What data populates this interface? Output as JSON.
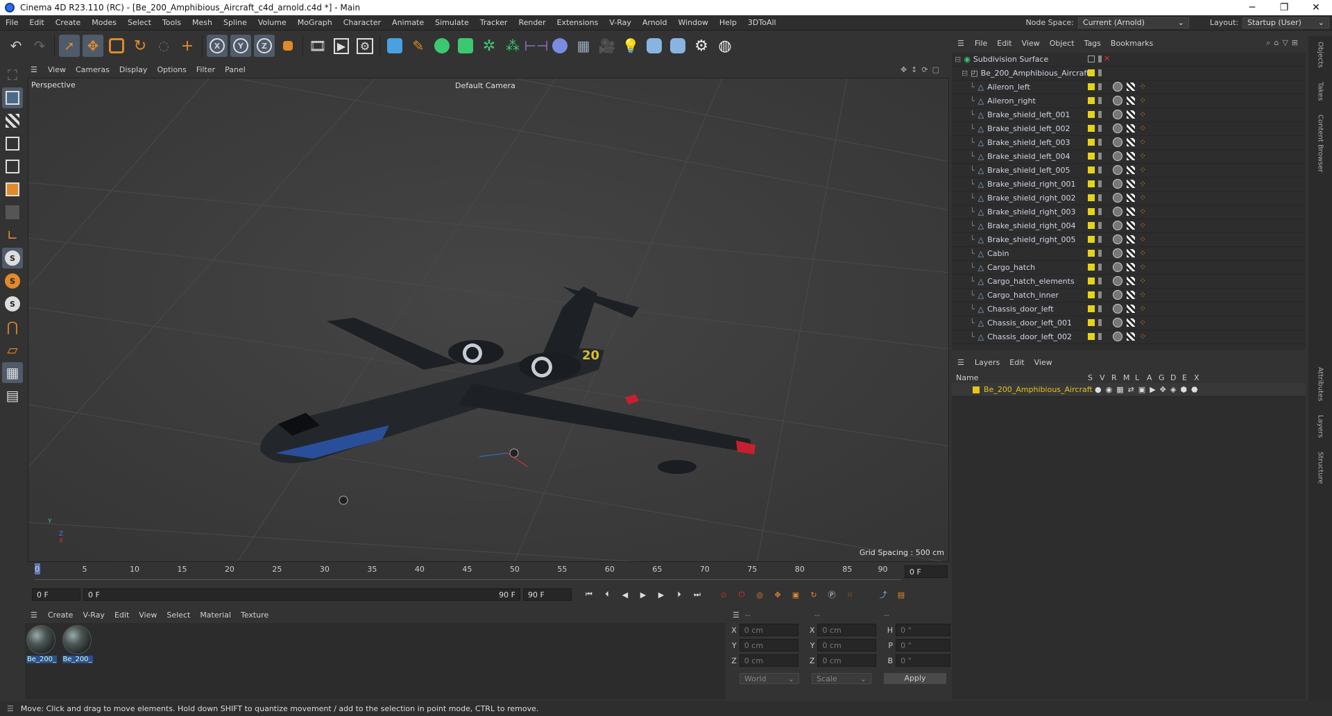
{
  "window": {
    "title": "Cinema 4D R23.110 (RC) - [Be_200_Amphibious_Aircraft_c4d_arnold.c4d *] - Main",
    "controls": [
      "─",
      "❐",
      "✕"
    ]
  },
  "menubar": {
    "items": [
      "File",
      "Edit",
      "Create",
      "Modes",
      "Select",
      "Tools",
      "Mesh",
      "Spline",
      "Volume",
      "MoGraph",
      "Character",
      "Animate",
      "Simulate",
      "Tracker",
      "Render",
      "Extensions",
      "V-Ray",
      "Arnold",
      "Window",
      "Help",
      "3DToAll"
    ],
    "node_space_label": "Node Space:",
    "node_space_value": "Current (Arnold)",
    "layout_label": "Layout:",
    "layout_value": "Startup (User)"
  },
  "toolbar": {
    "icons": [
      "undo-icon",
      "redo-icon",
      "select-icon",
      "move-icon",
      "scale-icon",
      "rotate-icon",
      "last-tool-icon",
      "recent-icon",
      "x-axis-icon",
      "y-axis-icon",
      "z-axis-icon",
      "coord-system-icon",
      "render-region-icon",
      "render-view-icon",
      "render-settings-icon",
      "cube-icon",
      "pen-icon",
      "subdivision-icon",
      "extrude-icon",
      "cloner-icon",
      "array-icon",
      "symmetry-icon",
      "deformer-icon",
      "floor-icon",
      "camera-icon",
      "light-icon",
      "python-icon",
      "python2-icon",
      "gear-icon",
      "globe-icon"
    ]
  },
  "viewport": {
    "menu": [
      "View",
      "Cameras",
      "Display",
      "Options",
      "Filter",
      "Panel"
    ],
    "label": "Perspective",
    "camera": "Default Camera",
    "grid_spacing": "Grid Spacing : 500 cm",
    "axis": {
      "y": "Y",
      "z": "Z",
      "x": "X"
    }
  },
  "timeline": {
    "ticks": [
      "0",
      "5",
      "10",
      "15",
      "20",
      "25",
      "30",
      "35",
      "40",
      "45",
      "50",
      "55",
      "60",
      "65",
      "70",
      "75",
      "80",
      "85",
      "90"
    ],
    "current_frame": "0 F",
    "start": "0 F",
    "range_start": "0 F",
    "range_end": "90 F",
    "end": "90 F"
  },
  "material": {
    "menu": [
      "Create",
      "V-Ray",
      "Edit",
      "View",
      "Select",
      "Material",
      "Texture"
    ],
    "items": [
      {
        "name": "Be_200_"
      },
      {
        "name": "Be_200_"
      }
    ]
  },
  "coords": {
    "header": [
      "--",
      "--",
      "--"
    ],
    "rows": [
      {
        "a": "X",
        "av": "0 cm",
        "b": "X",
        "bv": "0 cm",
        "c": "H",
        "cv": "0 °"
      },
      {
        "a": "Y",
        "av": "0 cm",
        "b": "Y",
        "bv": "0 cm",
        "c": "P",
        "cv": "0 °"
      },
      {
        "a": "Z",
        "av": "0 cm",
        "b": "Z",
        "bv": "0 cm",
        "c": "B",
        "cv": "0 °"
      }
    ],
    "world": "World",
    "scale": "Scale",
    "apply": "Apply"
  },
  "status": "Move: Click and drag to move elements. Hold down SHIFT to quantize movement / add to the selection in point mode, CTRL to remove.",
  "objects": {
    "menu": [
      "File",
      "Edit",
      "View",
      "Object",
      "Tags",
      "Bookmarks"
    ],
    "root": "Subdivision Surface",
    "group": "Be_200_Amphibious_Aircraft",
    "items": [
      "Aileron_left",
      "Aileron_right",
      "Brake_shield_left_001",
      "Brake_shield_left_002",
      "Brake_shield_left_003",
      "Brake_shield_left_004",
      "Brake_shield_left_005",
      "Brake_shield_right_001",
      "Brake_shield_right_002",
      "Brake_shield_right_003",
      "Brake_shield_right_004",
      "Brake_shield_right_005",
      "Cabin",
      "Cargo_hatch",
      "Cargo_hatch_elements",
      "Cargo_hatch_inner",
      "Chassis_door_left",
      "Chassis_door_left_001",
      "Chassis_door_left_002"
    ]
  },
  "layers": {
    "menu": [
      "Layers",
      "Edit",
      "View"
    ],
    "columns": [
      "Name",
      "S",
      "V",
      "R",
      "M",
      "L",
      "A",
      "G",
      "D",
      "E",
      "X"
    ],
    "items": [
      {
        "name": "Be_200_Amphibious_Aircraft",
        "color": "#e5c51a"
      }
    ]
  },
  "right_tabs": [
    "Objects",
    "Takes",
    "Content Browser",
    "Attributes",
    "Layers",
    "Structure"
  ],
  "colors": {
    "accent": "#4f5b6b",
    "layer_yellow": "#e5d31a",
    "highlight_orange": "#e08a2b",
    "selection_blue": "#2d4f8c"
  }
}
